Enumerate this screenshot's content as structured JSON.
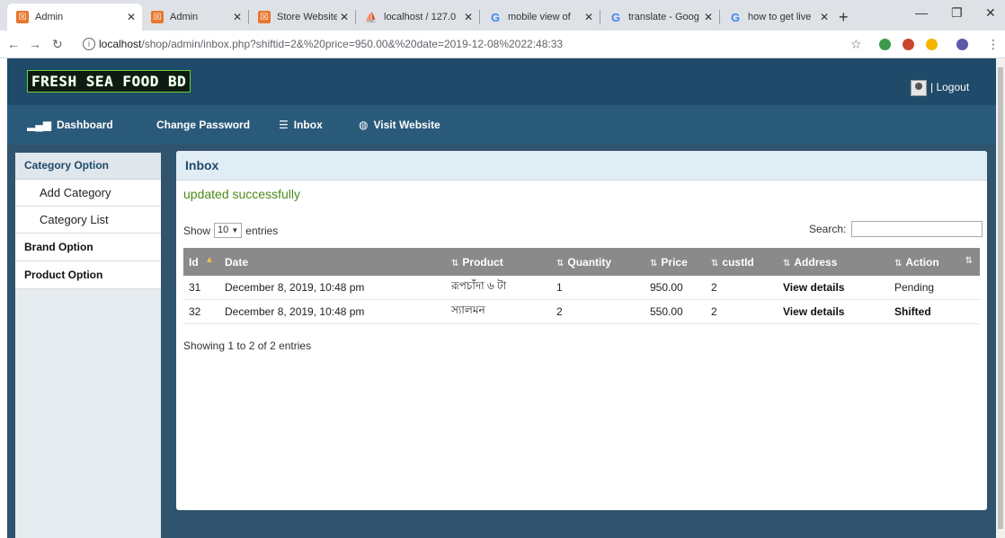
{
  "browser": {
    "tabs": [
      {
        "title": "Admin",
        "favicon": "admin-favicon"
      },
      {
        "title": "Admin",
        "favicon": "admin-favicon"
      },
      {
        "title": "Store Website",
        "favicon": "store-favicon"
      },
      {
        "title": "localhost / 127.0",
        "favicon": "phpmyadmin-favicon"
      },
      {
        "title": "mobile view of",
        "favicon": "google-favicon"
      },
      {
        "title": "translate - Goog",
        "favicon": "google-favicon"
      },
      {
        "title": "how to get live",
        "favicon": "google-favicon"
      }
    ],
    "url_host": "localhost",
    "url_path": "/shop/admin/inbox.php?shiftid=2&%20price=950.00&%20date=2019-12-08%2022:48:33"
  },
  "header": {
    "logo": "FRESH SEA FOOD BD",
    "logout": "| Logout"
  },
  "nav": {
    "items": [
      {
        "label": "Dashboard",
        "icon": "bar-chart-icon"
      },
      {
        "label": "Change Password",
        "icon": ""
      },
      {
        "label": "Inbox",
        "icon": "list-icon"
      },
      {
        "label": "Visit Website",
        "icon": "globe-icon"
      }
    ]
  },
  "sidebar": {
    "category_option": "Category Option",
    "items": [
      "Add Category",
      "Category List"
    ],
    "brand_option": "Brand Option",
    "product_option": "Product Option"
  },
  "main": {
    "title": "Inbox",
    "message": "updated successfully",
    "show_label": "Show",
    "entries_value": "10",
    "entries_label": "entries",
    "search_label": "Search:",
    "search_value": "",
    "info": "Showing 1 to 2 of 2 entries",
    "columns": [
      "Id",
      "Date",
      "Product",
      "Quantity",
      "Price",
      "custId",
      "Address",
      "Action"
    ],
    "rows": [
      {
        "id": "31",
        "date": "December 8, 2019, 10:48 pm",
        "product": "রূপচাঁদা ৬ টা",
        "quantity": "1",
        "price": "950.00",
        "custId": "2",
        "address": "View details",
        "action": "Pending"
      },
      {
        "id": "32",
        "date": "December 8, 2019, 10:48 pm",
        "product": "স্যালমন",
        "quantity": "2",
        "price": "550.00",
        "custId": "2",
        "address": "View details",
        "action": "Shifted"
      }
    ]
  },
  "colors": {
    "header": "#204a6a",
    "nav": "#2a5a7a",
    "table_header": "#8a8a8a",
    "success": "#4c8a1a"
  }
}
